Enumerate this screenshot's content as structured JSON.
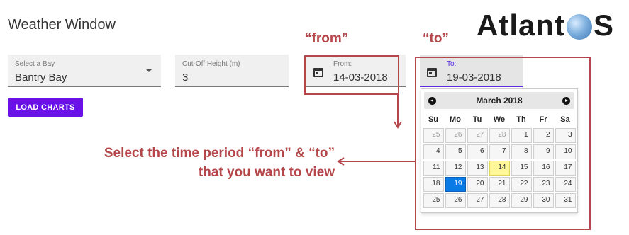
{
  "page": {
    "title": "Weather Window"
  },
  "logo": {
    "text_before": "Atlant",
    "text_after": "S"
  },
  "bay_select": {
    "label": "Select a Bay",
    "value": "Bantry Bay"
  },
  "cutoff_field": {
    "label": "Cut-Off Height (m)",
    "value": "3"
  },
  "from_field": {
    "label": "From:",
    "value": "14-03-2018"
  },
  "to_field": {
    "label": "To:",
    "value": "19-03-2018"
  },
  "load_button": {
    "label": "LOAD CHARTS"
  },
  "annotations": {
    "from": "“from”",
    "to": "“to”",
    "line1": "Select the time period “from” & “to”",
    "line2": "that you want to view"
  },
  "calendar": {
    "month": "March 2018",
    "weekdays": [
      "Su",
      "Mo",
      "Tu",
      "We",
      "Th",
      "Fr",
      "Sa"
    ],
    "weeks": [
      [
        "25",
        "26",
        "27",
        "28",
        "1",
        "2",
        "3"
      ],
      [
        "4",
        "5",
        "6",
        "7",
        "8",
        "9",
        "10"
      ],
      [
        "11",
        "12",
        "13",
        "14",
        "15",
        "16",
        "17"
      ],
      [
        "18",
        "19",
        "20",
        "21",
        "22",
        "23",
        "24"
      ],
      [
        "25",
        "26",
        "27",
        "28",
        "29",
        "30",
        "31"
      ]
    ],
    "today": "14",
    "selected": "19"
  },
  "colors": {
    "accent": "#6a11e8",
    "annotation": "#b5474b",
    "selected_day": "#0a7ae6",
    "today": "#fff79a"
  }
}
